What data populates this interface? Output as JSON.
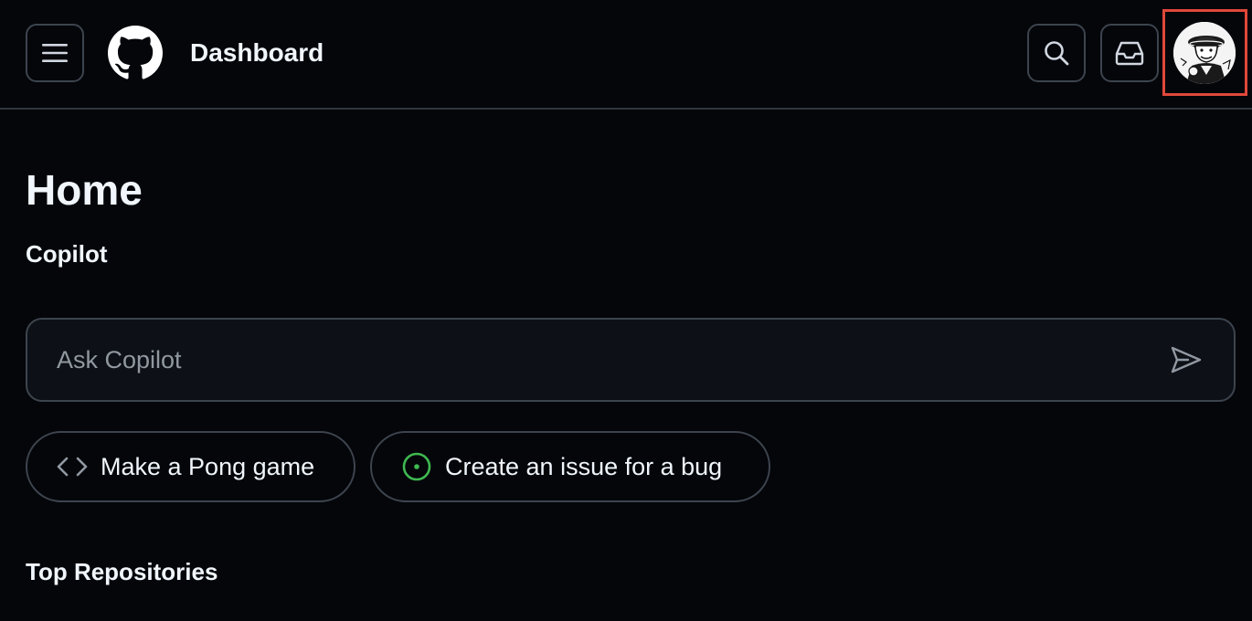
{
  "header": {
    "title": "Dashboard",
    "icons": {
      "menu": "hamburger-menu-icon",
      "logo": "github-logo-icon",
      "search": "search-icon",
      "inbox": "inbox-icon",
      "avatar": "user-avatar"
    }
  },
  "main": {
    "title": "Home",
    "copilot": {
      "label": "Copilot",
      "ask_placeholder": "Ask Copilot",
      "send_icon": "send-icon",
      "suggestions": [
        {
          "label": "Make a Pong game",
          "icon": "code-icon"
        },
        {
          "label": "Create an issue for a bug",
          "icon": "issue-opened-icon"
        }
      ]
    },
    "top_repositories_label": "Top Repositories"
  },
  "colors": {
    "background": "#04060a",
    "border": "#3d444d",
    "input_background": "#0d1117",
    "text": "#f0f6fc",
    "placeholder": "#9198a1",
    "issue_green": "#3fb950",
    "highlight_red": "#e0483a"
  }
}
